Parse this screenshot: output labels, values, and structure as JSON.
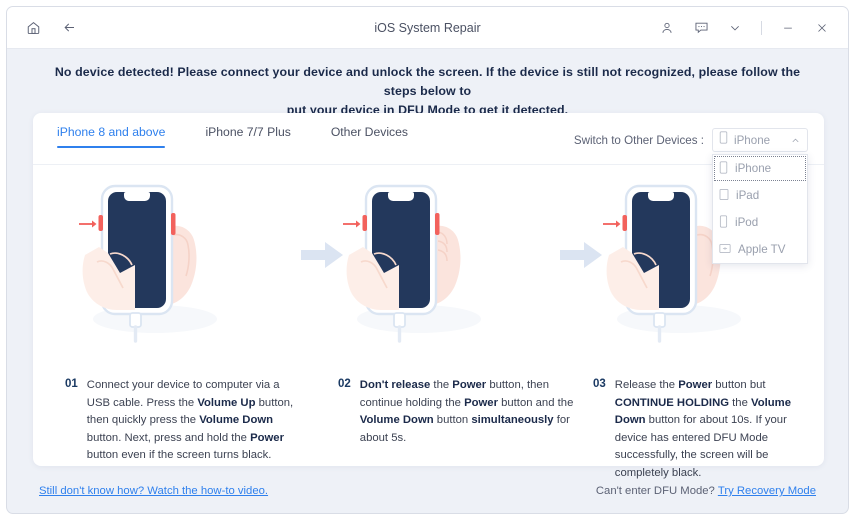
{
  "window": {
    "title": "iOS System Repair",
    "titlebar_icons": {
      "home": "home-icon",
      "back": "back-arrow-icon",
      "account": "account-icon",
      "feedback": "message-bubble-icon",
      "menu": "chevron-down-icon",
      "minimize": "minimize-icon",
      "close": "close-icon"
    }
  },
  "banner": {
    "line1": "No device detected! Please connect your device and unlock the screen. If the device is still not recognized, please follow the steps below to",
    "line2": "put your device in DFU Mode to get it detected."
  },
  "tabs": [
    {
      "label": "iPhone 8 and above",
      "active": true
    },
    {
      "label": "iPhone 7/7 Plus",
      "active": false
    },
    {
      "label": "Other Devices",
      "active": false
    }
  ],
  "switch_device": {
    "label": "Switch to Other Devices :",
    "selected": "iPhone",
    "expanded": true,
    "options": [
      {
        "label": "iPhone",
        "icon": "iphone-icon",
        "selected": true
      },
      {
        "label": "iPad",
        "icon": "ipad-icon",
        "selected": false
      },
      {
        "label": "iPod",
        "icon": "ipod-icon",
        "selected": false
      },
      {
        "label": "Apple TV",
        "icon": "appletv-icon",
        "selected": false
      }
    ]
  },
  "steps": [
    {
      "number": "01",
      "parts": [
        {
          "t": "Connect your device to computer via a USB cable. Press the ",
          "b": false
        },
        {
          "t": "Volume Up",
          "b": true
        },
        {
          "t": " button, then quickly press the ",
          "b": false
        },
        {
          "t": "Volume Down",
          "b": true
        },
        {
          "t": " button. Next, press and hold the ",
          "b": false
        },
        {
          "t": "Power",
          "b": true
        },
        {
          "t": " button even if the screen turns black.",
          "b": false
        }
      ]
    },
    {
      "number": "02",
      "parts": [
        {
          "t": "Don't release",
          "b": true
        },
        {
          "t": " the ",
          "b": false
        },
        {
          "t": "Power",
          "b": true
        },
        {
          "t": " button, then continue holding the ",
          "b": false
        },
        {
          "t": "Power",
          "b": true
        },
        {
          "t": " button and the ",
          "b": false
        },
        {
          "t": "Volume Down",
          "b": true
        },
        {
          "t": " button ",
          "b": false
        },
        {
          "t": "simultaneously",
          "b": true
        },
        {
          "t": " for about 5s.",
          "b": false
        }
      ]
    },
    {
      "number": "03",
      "parts": [
        {
          "t": "Release the ",
          "b": false
        },
        {
          "t": "Power",
          "b": true
        },
        {
          "t": " button but ",
          "b": false
        },
        {
          "t": "CONTINUE HOLDING",
          "b": true
        },
        {
          "t": " the ",
          "b": false
        },
        {
          "t": "Volume Down",
          "b": true
        },
        {
          "t": " button for about 10s. If your device has entered DFU Mode successfully, the screen will be completely black.",
          "b": false
        }
      ]
    }
  ],
  "footer": {
    "video_link": "Still don't know how? Watch the how-to video.",
    "right_text": "Can't enter DFU Mode?",
    "recovery_link": "Try Recovery Mode"
  },
  "colors": {
    "accent": "#2f80ed",
    "page_bg": "#eef1f7",
    "card_bg": "#ffffff",
    "banner_text": "#1b2a4a",
    "phone_screen": "#23385c",
    "button_highlight": "#f2615c",
    "arrow": "#dbe4f2"
  }
}
